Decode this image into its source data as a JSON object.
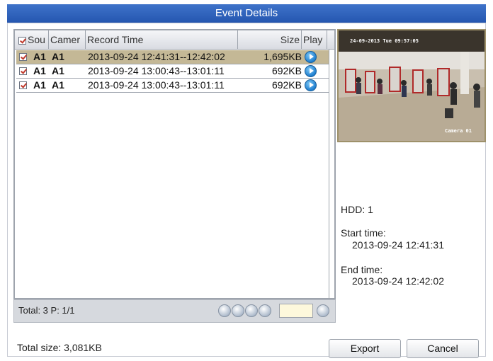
{
  "window": {
    "title": "Event Details"
  },
  "table": {
    "columns": [
      "Sou",
      "Camer",
      "Record Time",
      "Size",
      "Play"
    ],
    "rows": [
      {
        "source": "A1",
        "camera": "A1",
        "record_time": "2013-09-24 12:41:31--12:42:02",
        "size": "1,695KB",
        "selected": true
      },
      {
        "source": "A1",
        "camera": "A1",
        "record_time": "2013-09-24 13:00:43--13:01:11",
        "size": "692KB",
        "selected": false
      },
      {
        "source": "A1",
        "camera": "A1",
        "record_time": "2013-09-24 13:00:43--13:01:11",
        "size": "692KB",
        "selected": false
      }
    ]
  },
  "pager": {
    "total_label": "Total: 3  P: 1/1",
    "page_input": ""
  },
  "preview": {
    "timestamp": "24-09-2013 Tue 09:57:05",
    "camera_label": "Camera 01"
  },
  "details": {
    "hdd": "HDD: 1",
    "start_label": "Start time:",
    "start_value": "2013-09-24 12:41:31",
    "end_label": "End time:",
    "end_value": "2013-09-24 12:42:02"
  },
  "summary": {
    "total_size": "Total size: 3,081KB"
  },
  "buttons": {
    "export": "Export",
    "cancel": "Cancel"
  },
  "colors": {
    "title_bar": "#2f63bf",
    "selected_row": "#c4b896",
    "page_input_bg": "#fdf8dc"
  }
}
